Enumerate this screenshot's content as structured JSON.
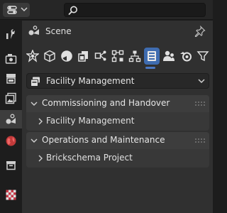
{
  "header": {
    "search": {
      "placeholder": "",
      "value": ""
    }
  },
  "context": {
    "label": "Scene"
  },
  "colors": {
    "accent": "#3f6cb0",
    "panel_header": "#3d3d3d",
    "panel_body": "#383838",
    "background": "#303030"
  },
  "left_tabs": [
    {
      "icon": "tool-icon"
    },
    {
      "icon": "render-icon"
    },
    {
      "icon": "output-icon"
    },
    {
      "icon": "view-layer-icon"
    },
    {
      "icon": "scene-icon",
      "active": true
    },
    {
      "icon": "world-icon"
    },
    {
      "icon": "collection-icon"
    },
    {
      "icon": "texture-icon"
    }
  ],
  "property_tabs": [
    {
      "icon": "scene-icon"
    },
    {
      "icon": "object-icon"
    },
    {
      "icon": "material-shading-icon"
    },
    {
      "icon": "collection-copy-icon"
    },
    {
      "icon": "share-icon"
    },
    {
      "icon": "node-link-icon"
    },
    {
      "icon": "node-tree-icon"
    },
    {
      "icon": "facility-icon",
      "active": true
    },
    {
      "icon": "users-icon"
    },
    {
      "icon": "blender-icon"
    },
    {
      "icon": "filter-icon"
    }
  ],
  "dropdown": {
    "label": "Facility Management"
  },
  "panels": [
    {
      "title": "Commissioning and Handover",
      "expanded": true,
      "children": [
        {
          "label": "Facility Management",
          "expanded": false
        }
      ]
    },
    {
      "title": "Operations and Maintenance",
      "expanded": true,
      "children": [
        {
          "label": "Brickschema Project",
          "expanded": false
        }
      ]
    }
  ]
}
